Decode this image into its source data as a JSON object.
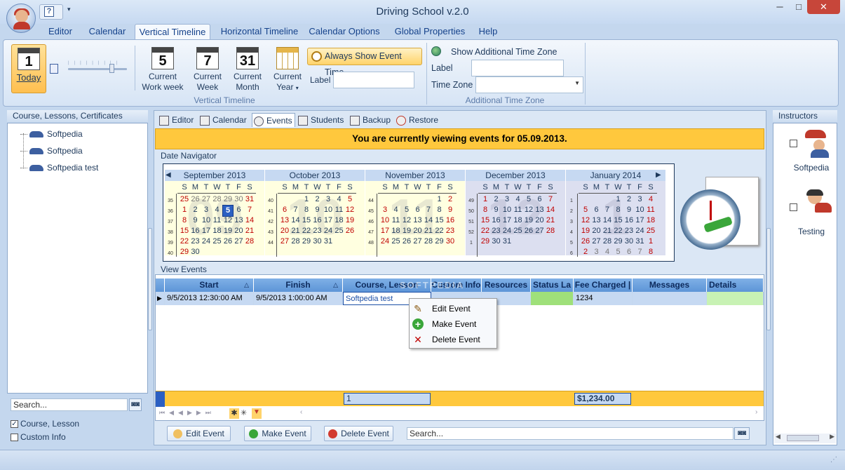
{
  "app": {
    "title": "Driving School v.2.0"
  },
  "menu_tabs": [
    "Editor",
    "Calendar",
    "Vertical Timeline",
    "Horizontal Timeline",
    "Calendar Options",
    "Global Properties",
    "Help"
  ],
  "active_tab": "Vertical Timeline",
  "ribbon": {
    "today_num": "1",
    "today_label": "Today",
    "current_work_week_num": "5",
    "current_work_week_label1": "Current",
    "current_work_week_label2": "Work week",
    "current_week_num": "7",
    "current_week_label1": "Current",
    "current_week_label2": "Week",
    "current_month_num": "31",
    "current_month_label1": "Current",
    "current_month_label2": "Month",
    "current_year_label1": "Current",
    "current_year_label2": "Year",
    "always_show_event_time": "Always Show Event Time",
    "label_field": "Label",
    "group_vertical_timeline": "Vertical Timeline",
    "show_additional_time_zone": "Show Additional Time Zone",
    "atz_label": "Label",
    "atz_time_zone": "Time Zone",
    "group_additional_time_zone": "Additional Time Zone"
  },
  "left_panel": {
    "header": "Course, Lessons, Certificates",
    "items": [
      "Softpedia",
      "Softpedia",
      "Softpedia test"
    ],
    "search_placeholder": "Search...",
    "check_course": "Course, Lesson",
    "check_course_checked": true,
    "check_custom": "Custom Info",
    "check_custom_checked": false
  },
  "sub_tabs": [
    "Editor",
    "Calendar",
    "Events",
    "Students",
    "Backup",
    "Restore"
  ],
  "active_sub_tab": "Events",
  "banner": "You are currently viewing events for 05.09.2013.",
  "date_navigator": {
    "label": "Date Navigator",
    "dow": [
      "S",
      "M",
      "T",
      "W",
      "T",
      "F",
      "S"
    ],
    "months": [
      {
        "name": "September 2013",
        "watermark": "09",
        "weeks": [
          "35",
          "36",
          "37",
          "38",
          "39",
          "40"
        ],
        "rows": [
          [
            "25",
            "26",
            "27",
            "28",
            "29",
            "30",
            "31"
          ],
          [
            "1",
            "2",
            "3",
            "4",
            "5",
            "6",
            "7"
          ],
          [
            "8",
            "9",
            "10",
            "11",
            "12",
            "13",
            "14"
          ],
          [
            "15",
            "16",
            "17",
            "18",
            "19",
            "20",
            "21"
          ],
          [
            "22",
            "23",
            "24",
            "25",
            "26",
            "27",
            "28"
          ],
          [
            "29",
            "30",
            "",
            "",
            "",
            "",
            ""
          ]
        ]
      },
      {
        "name": "October 2013",
        "watermark": "10",
        "weeks": [
          "40",
          "41",
          "42",
          "43",
          "44",
          ""
        ],
        "rows": [
          [
            "",
            "",
            "1",
            "2",
            "3",
            "4",
            "5"
          ],
          [
            "6",
            "7",
            "8",
            "9",
            "10",
            "11",
            "12"
          ],
          [
            "13",
            "14",
            "15",
            "16",
            "17",
            "18",
            "19"
          ],
          [
            "20",
            "21",
            "22",
            "23",
            "24",
            "25",
            "26"
          ],
          [
            "27",
            "28",
            "29",
            "30",
            "31",
            "",
            ""
          ],
          [
            "",
            "",
            "",
            "",
            "",
            "",
            ""
          ]
        ]
      },
      {
        "name": "November 2013",
        "watermark": "11",
        "weeks": [
          "44",
          "45",
          "46",
          "47",
          "48",
          ""
        ],
        "rows": [
          [
            "",
            "",
            "",
            "",
            "",
            "1",
            "2"
          ],
          [
            "3",
            "4",
            "5",
            "6",
            "7",
            "8",
            "9"
          ],
          [
            "10",
            "11",
            "12",
            "13",
            "14",
            "15",
            "16"
          ],
          [
            "17",
            "18",
            "19",
            "20",
            "21",
            "22",
            "23"
          ],
          [
            "24",
            "25",
            "26",
            "27",
            "28",
            "29",
            "30"
          ],
          [
            "",
            "",
            "",
            "",
            "",
            "",
            ""
          ]
        ]
      },
      {
        "name": "December 2013",
        "watermark": "12",
        "weeks": [
          "49",
          "50",
          "51",
          "52",
          "1",
          ""
        ],
        "rows": [
          [
            "1",
            "2",
            "3",
            "4",
            "5",
            "6",
            "7"
          ],
          [
            "8",
            "9",
            "10",
            "11",
            "12",
            "13",
            "14"
          ],
          [
            "15",
            "16",
            "17",
            "18",
            "19",
            "20",
            "21"
          ],
          [
            "22",
            "23",
            "24",
            "25",
            "26",
            "27",
            "28"
          ],
          [
            "29",
            "30",
            "31",
            "",
            "",
            "",
            ""
          ],
          [
            "",
            "",
            "",
            "",
            "",
            "",
            ""
          ]
        ]
      },
      {
        "name": "January 2014",
        "watermark": "1",
        "weeks": [
          "1",
          "2",
          "3",
          "4",
          "5",
          "6"
        ],
        "rows": [
          [
            "",
            "",
            "",
            "1",
            "2",
            "3",
            "4"
          ],
          [
            "5",
            "6",
            "7",
            "8",
            "9",
            "10",
            "11"
          ],
          [
            "12",
            "13",
            "14",
            "15",
            "16",
            "17",
            "18"
          ],
          [
            "19",
            "20",
            "21",
            "22",
            "23",
            "24",
            "25"
          ],
          [
            "26",
            "27",
            "28",
            "29",
            "30",
            "31",
            "1"
          ],
          [
            "2",
            "3",
            "4",
            "5",
            "6",
            "7",
            "8"
          ]
        ]
      }
    ]
  },
  "view_events": {
    "label": "View Events",
    "columns": [
      "Start",
      "Finish",
      "Course, Lesson",
      "Custom Info",
      "Resources",
      "Status La",
      "Fee Charged |",
      "Messages",
      "Details"
    ],
    "rows": [
      {
        "start": "9/5/2013 12:30:00 AM",
        "finish": "9/5/2013 1:00:00 AM",
        "course": "Softpedia test",
        "custom": "",
        "resources": "",
        "status": "",
        "fee": "1234",
        "messages": "",
        "details": ""
      }
    ],
    "summary_count": "1",
    "summary_fee": "$1,234.00",
    "status_color": "#9fe07a",
    "details_color": "#c8f2b4"
  },
  "context_menu": [
    "Edit Event",
    "Make Event",
    "Delete Event"
  ],
  "bottom_buttons": {
    "edit": "Edit Event",
    "make": "Make Event",
    "delete": "Delete Event",
    "search_placeholder": "Search..."
  },
  "instructors": {
    "header": "Instructors",
    "items": [
      {
        "name": "Softpedia"
      },
      {
        "name": "Testing"
      }
    ]
  },
  "watermark": "SOFTPEDIA"
}
